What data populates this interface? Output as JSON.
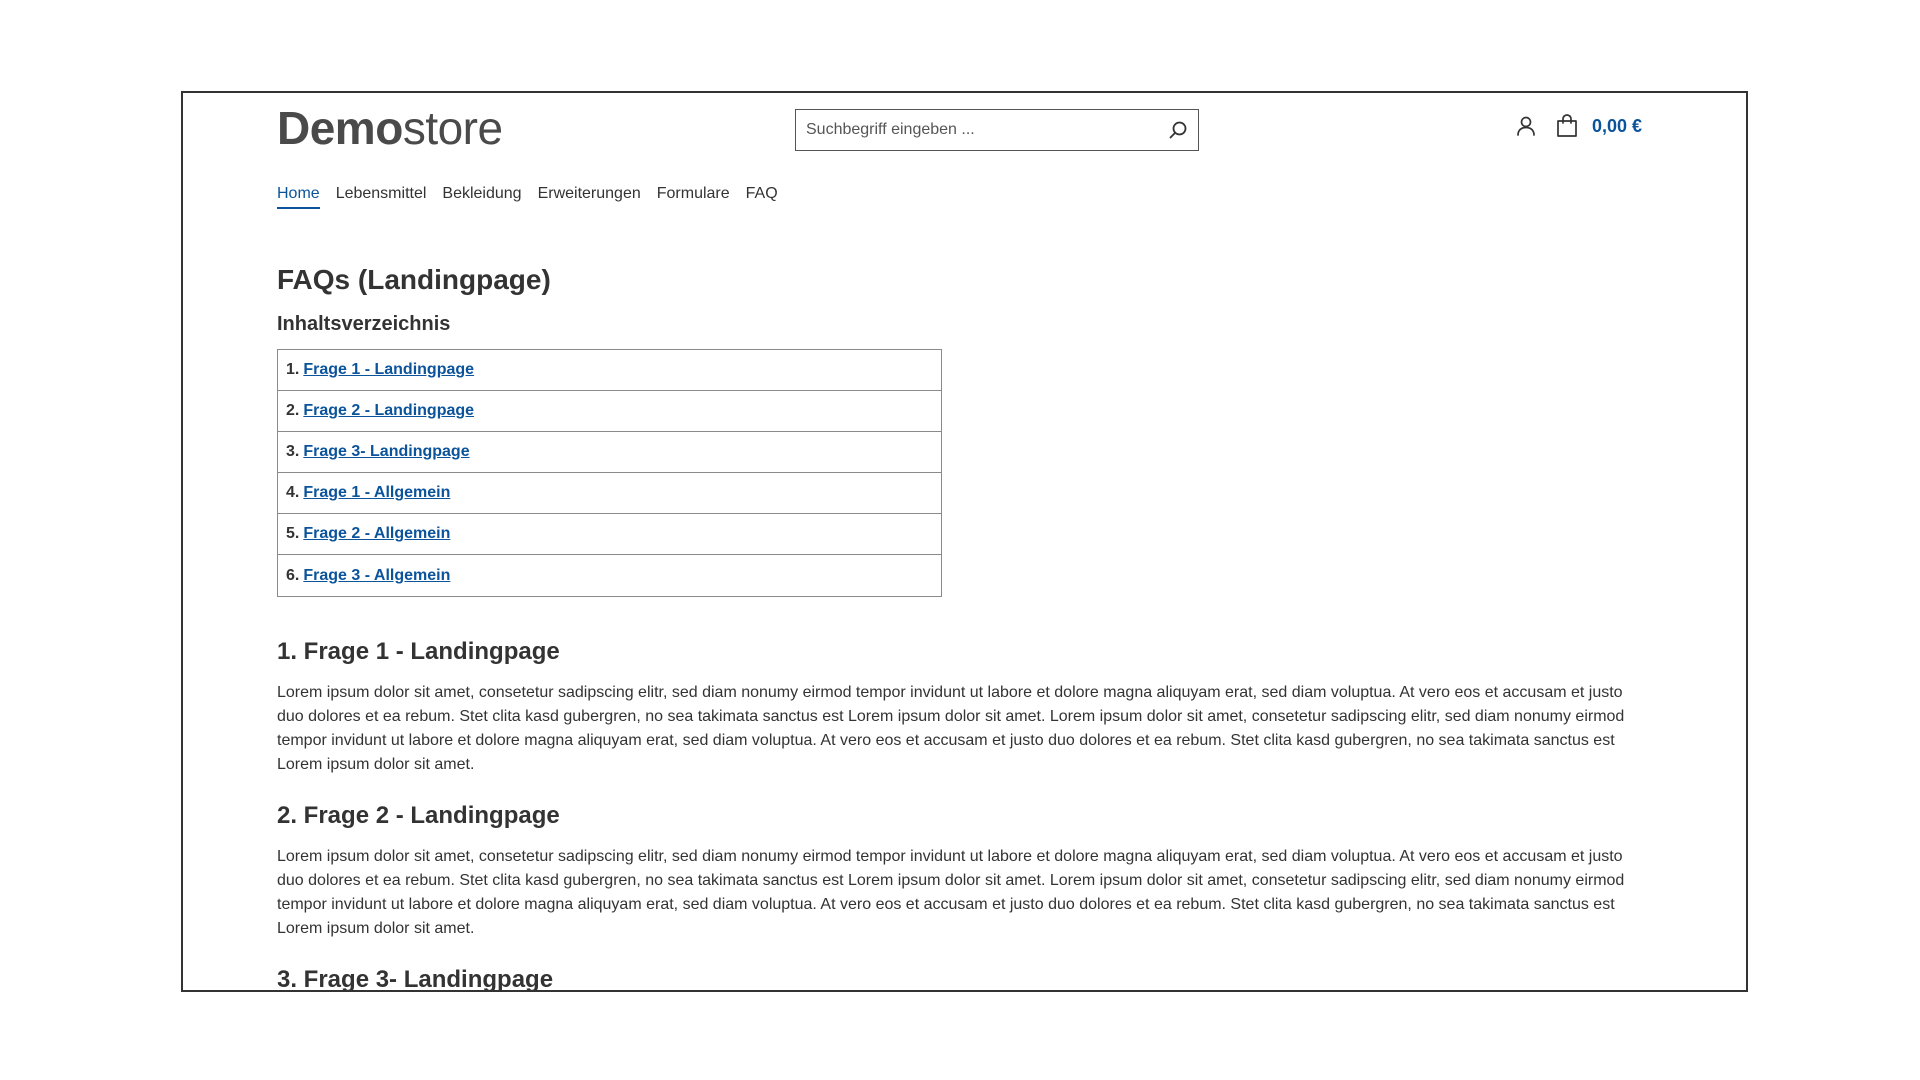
{
  "header": {
    "logo_bold": "Demo",
    "logo_light": "store",
    "search_placeholder": "Suchbegriff eingeben ...",
    "cart_total": "0,00 €"
  },
  "nav": {
    "items": [
      {
        "label": "Home",
        "active": true
      },
      {
        "label": "Lebensmittel"
      },
      {
        "label": "Bekleidung"
      },
      {
        "label": "Erweiterungen"
      },
      {
        "label": "Formulare"
      },
      {
        "label": "FAQ"
      }
    ]
  },
  "main": {
    "title": "FAQs (Landingpage)",
    "toc_title": "Inhaltsverzeichnis",
    "toc": [
      {
        "num": "1.",
        "label": "Frage 1 - Landingpage"
      },
      {
        "num": "2.",
        "label": "Frage 2 - Landingpage"
      },
      {
        "num": "3.",
        "label": "Frage 3- Landingpage"
      },
      {
        "num": "4.",
        "label": "Frage 1 - Allgemein"
      },
      {
        "num": "5.",
        "label": "Frage 2 - Allgemein"
      },
      {
        "num": "6.",
        "label": "Frage 3 - Allgemein"
      }
    ],
    "sections": [
      {
        "title": "1. Frage 1 - Landingpage",
        "text": "Lorem ipsum dolor sit amet, consetetur sadipscing elitr, sed diam nonumy eirmod tempor invidunt ut labore et dolore magna aliquyam erat, sed diam voluptua. At vero eos et accusam et justo duo dolores et ea rebum. Stet clita kasd gubergren, no sea takimata sanctus est Lorem ipsum dolor sit amet. Lorem ipsum dolor sit amet, consetetur sadipscing elitr, sed diam nonumy eirmod tempor invidunt ut labore et dolore magna aliquyam erat, sed diam voluptua. At vero eos et accusam et justo duo dolores et ea rebum. Stet clita kasd gubergren, no sea takimata sanctus est Lorem ipsum dolor sit amet."
      },
      {
        "title": "2. Frage 2 - Landingpage",
        "text": "Lorem ipsum dolor sit amet, consetetur sadipscing elitr, sed diam nonumy eirmod tempor invidunt ut labore et dolore magna aliquyam erat, sed diam voluptua. At vero eos et accusam et justo duo dolores et ea rebum. Stet clita kasd gubergren, no sea takimata sanctus est Lorem ipsum dolor sit amet. Lorem ipsum dolor sit amet, consetetur sadipscing elitr, sed diam nonumy eirmod tempor invidunt ut labore et dolore magna aliquyam erat, sed diam voluptua. At vero eos et accusam et justo duo dolores et ea rebum. Stet clita kasd gubergren, no sea takimata sanctus est Lorem ipsum dolor sit amet."
      },
      {
        "title": "3. Frage 3- Landingpage"
      }
    ]
  },
  "colors": {
    "accent": "#0b539b",
    "text": "#333333",
    "border": "#8a8a8a"
  },
  "icons": {
    "search": "search-icon",
    "account": "user-icon",
    "cart": "shopping-bag-icon"
  }
}
